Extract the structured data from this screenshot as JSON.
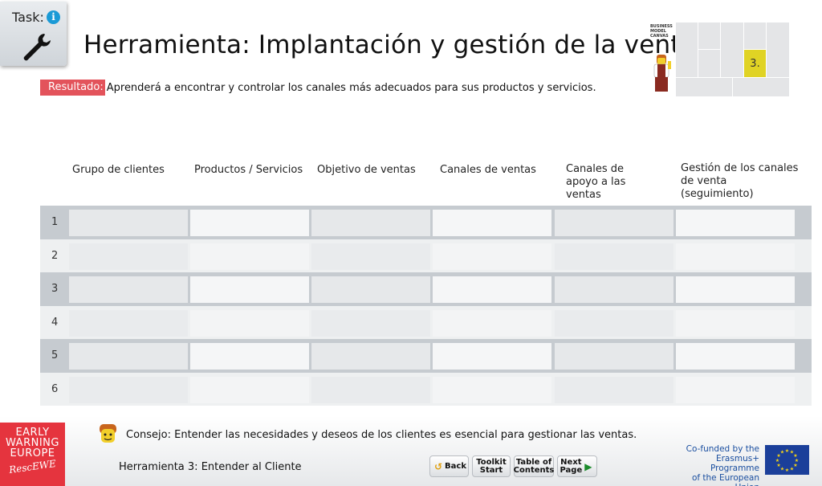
{
  "task": {
    "label": "Task:",
    "info_icon": "i"
  },
  "header": {
    "title": "Herramienta: Implantación y gestión de la venta",
    "result_label": "Resultado:",
    "result_text": "Aprenderá a encontrar y controlar los canales más adecuados para sus productos y servicios."
  },
  "bmc": {
    "caption_line1": "BUSINESS",
    "caption_line2": "MODEL",
    "caption_line3": "CANVAS",
    "active_label": "3.",
    "active_color": "#e0d324"
  },
  "table": {
    "columns": [
      "Grupo de clientes",
      "Productos / Servicios",
      "Objetivo de ventas",
      "Canales de ventas",
      "Canales de apoyo a las ventas",
      "Gestión de los canales de venta (seguimiento)"
    ],
    "rows": [
      "1",
      "2",
      "3",
      "4",
      "5",
      "6"
    ]
  },
  "footer": {
    "logo_line1": "EARLY",
    "logo_line2": "WARNING",
    "logo_line3": "EUROPE",
    "logo_script": "RescEWE",
    "tip": "Consejo: Entender las necesidades y deseos de los clientes es esencial para gestionar las ventas.",
    "tool_name": "Herramienta 3: Entender al Cliente",
    "buttons": {
      "back": "Back",
      "toolkit_1": "Toolkit",
      "toolkit_2": "Start",
      "toc_1": "Table of",
      "toc_2": "Contents",
      "next_1": "Next",
      "next_2": "Page"
    },
    "eu_line1": "Co-funded by the",
    "eu_line2": "Erasmus+ Programme",
    "eu_line3": "of the European Union"
  },
  "colors": {
    "accent_red": "#e3535b",
    "eu_blue": "#1b3f9a"
  }
}
